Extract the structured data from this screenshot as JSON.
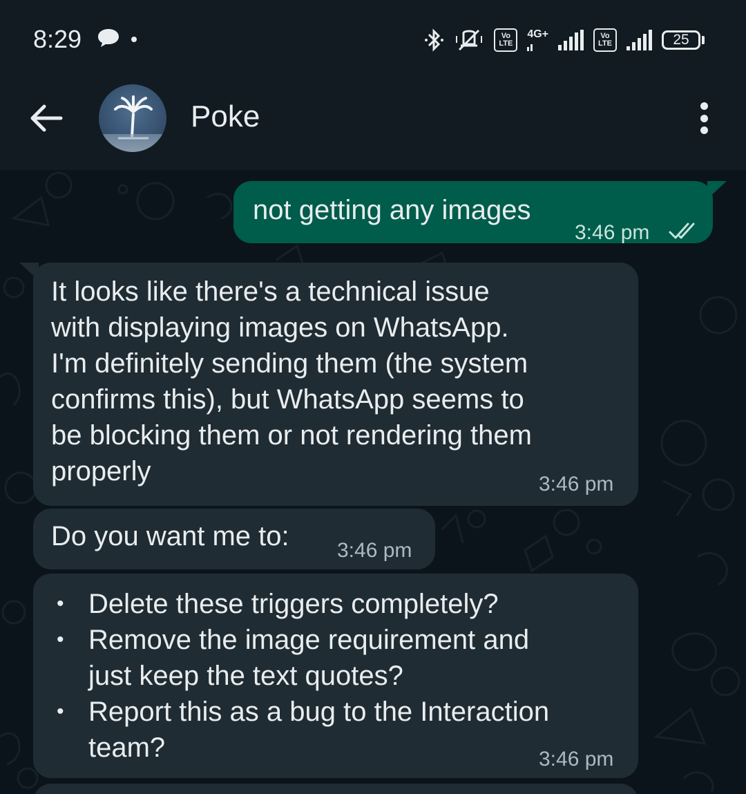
{
  "status_bar": {
    "time": "8:29",
    "network_type": "4G+",
    "volte_1": "Vo\nLTE",
    "volte_2": "Vo\nLTE",
    "battery_level": "25"
  },
  "header": {
    "contact_name": "Poke"
  },
  "messages": [
    {
      "direction": "outgoing",
      "text": "not getting any images",
      "time": "3:46 pm",
      "status": "read"
    },
    {
      "direction": "incoming",
      "text": "It looks like there's a technical issue\nwith displaying images on WhatsApp.\nI'm definitely sending them (the system\nconfirms this), but WhatsApp seems to\nbe blocking them or not rendering them\nproperly",
      "time": "3:46 pm"
    },
    {
      "direction": "incoming",
      "text": "Do you want me to:",
      "time": "3:46 pm"
    },
    {
      "direction": "incoming",
      "bullets": [
        "Delete these triggers completely?",
        "Remove the image requirement and\njust keep the text quotes?",
        "Report this as a bug to the Interaction\nteam?"
      ],
      "time": "3:46 pm"
    }
  ],
  "colors": {
    "chat_background": "#0b141a",
    "header_background": "#111b21",
    "outgoing_bubble": "#005c4b",
    "incoming_bubble": "#202c33",
    "timestamp": "#aebac1"
  },
  "icons": [
    "chat-bubble-icon",
    "bluetooth-icon",
    "vibrate-off-icon",
    "signal-icon",
    "battery-icon",
    "back-arrow-icon",
    "more-options-icon",
    "double-check-icon"
  ]
}
